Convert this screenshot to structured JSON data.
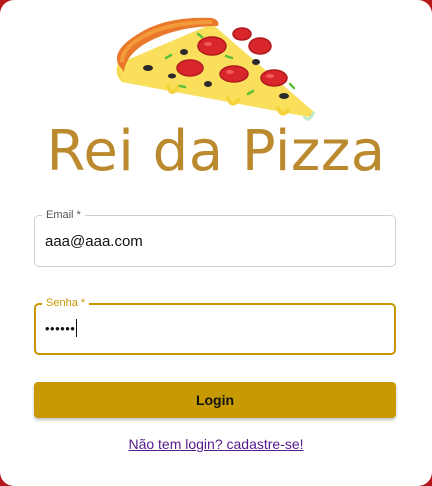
{
  "brand": {
    "title": "Rei da Pizza",
    "logo_icon": "pizza-slice-icon"
  },
  "form": {
    "email": {
      "label": "Email *",
      "value": "aaa@aaa.com"
    },
    "password": {
      "label": "Senha *",
      "value": "••••••"
    },
    "login_label": "Login",
    "signup_link": "Não tem login? cadastre-se!"
  },
  "colors": {
    "background": "#b5171b",
    "brand_text": "#bc8a2e",
    "accent": "#c69a00",
    "link": "#551a8b"
  }
}
